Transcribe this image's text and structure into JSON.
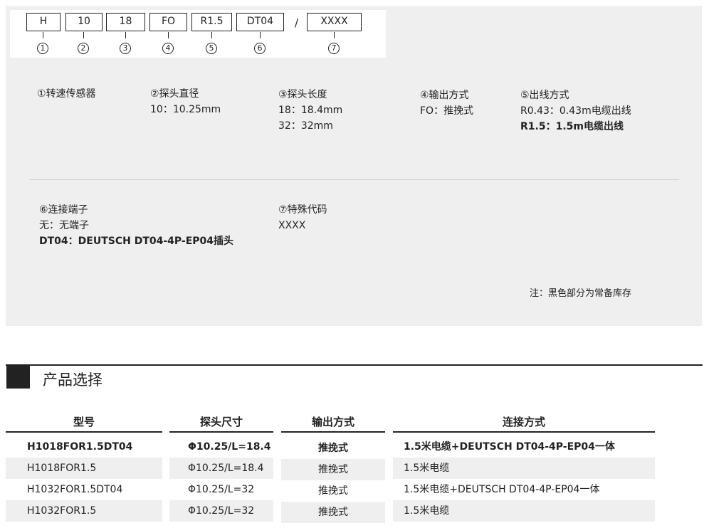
{
  "code_segments": [
    {
      "text": "H",
      "num": "1"
    },
    {
      "text": "10",
      "num": "2"
    },
    {
      "text": "18",
      "num": "3"
    },
    {
      "text": "FO",
      "num": "4"
    },
    {
      "text": "R1.5",
      "num": "5"
    },
    {
      "text": "DT04",
      "num": "6"
    },
    {
      "text": "XXXX",
      "num": "7"
    }
  ],
  "separator": "/",
  "definitions": {
    "d1": {
      "title": "①转速传感器"
    },
    "d2": {
      "title": "②探头直径",
      "lines": [
        "10：10.25mm"
      ]
    },
    "d3": {
      "title": "③探头长度",
      "lines": [
        "18：18.4mm",
        "32：32mm"
      ]
    },
    "d4": {
      "title": "④输出方式",
      "lines": [
        "FO：推挽式"
      ]
    },
    "d5": {
      "title": "⑤出线方式",
      "lines": [
        "R0.43：0.43m电缆出线",
        "R1.5：1.5m电缆出线"
      ]
    },
    "d6": {
      "title": "⑥连接端子",
      "lines": [
        "无：无端子",
        "DT04：DEUTSCH DT04-4P-EP04插头"
      ]
    },
    "d7": {
      "title": "⑦特殊代码",
      "lines": [
        "XXXX"
      ]
    }
  },
  "note": "注：黑色部分为常备库存",
  "selection": {
    "title": "产品选择",
    "headers": [
      "型号",
      "探头尺寸",
      "输出方式",
      "连接方式"
    ],
    "rows": [
      {
        "model": "H1018FOR1.5DT04",
        "size": "Φ10.25/L=18.4",
        "output": "推挽式",
        "connection": "1.5米电缆+DEUTSCH DT04-4P-EP04一体",
        "stocked": true
      },
      {
        "model": "H1018FOR1.5",
        "size": "Φ10.25/L=18.4",
        "output": "推挽式",
        "connection": "1.5米电缆",
        "stocked": false
      },
      {
        "model": "H1032FOR1.5DT04",
        "size": "Φ10.25/L=32",
        "output": "推挽式",
        "connection": "1.5米电缆+DEUTSCH DT04-4P-EP04一体",
        "stocked": false
      },
      {
        "model": "H1032FOR1.5",
        "size": "Φ10.25/L=32",
        "output": "推挽式",
        "connection": "1.5米电缆",
        "stocked": false
      }
    ]
  }
}
